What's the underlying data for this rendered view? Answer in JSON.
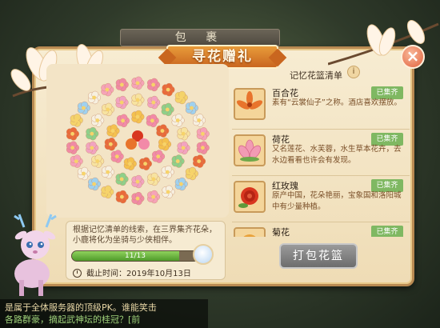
{
  "window": {
    "bag_title": "包 裹",
    "event_title": "寻花赠礼",
    "close_label": "×"
  },
  "list": {
    "heading": "记忆花篮清单",
    "info_label": "i",
    "items": [
      {
        "name": "百合花",
        "status": "已集齐",
        "desc": "素有“云裳仙子”之称。酒店喜欢摆放。",
        "color": "#e8742c"
      },
      {
        "name": "荷花",
        "status": "已集齐",
        "desc": "又名莲花、水芙蓉，水生草本花卉，去水边看看也许会有发现。",
        "color": "#f29bb4"
      },
      {
        "name": "红玫瑰",
        "status": "已集齐",
        "desc": "原产中国，花朵艳丽，宝象国和洛阳城中有少量种植。",
        "color": "#d8361f"
      },
      {
        "name": "菊花",
        "status": "已集齐",
        "desc": "",
        "color": "#e9a23a"
      }
    ]
  },
  "hint": {
    "text": "根据记忆清单的线索，在三界集齐花朵，小鹿将化为坐骑与少侠相伴。",
    "progress_text": "11/13",
    "progress_value": 0.846,
    "deadline": "截止时间：2019年10月13日"
  },
  "pack_button": "打包花篮",
  "chat": {
    "line1": "是属于全体服务器的顶级PK。谁能笑击",
    "line2": "各路群豪，摘起武神坛的桂冠？[前"
  },
  "colors": {
    "badge": "#7fb862",
    "accent": "#c9661f"
  }
}
